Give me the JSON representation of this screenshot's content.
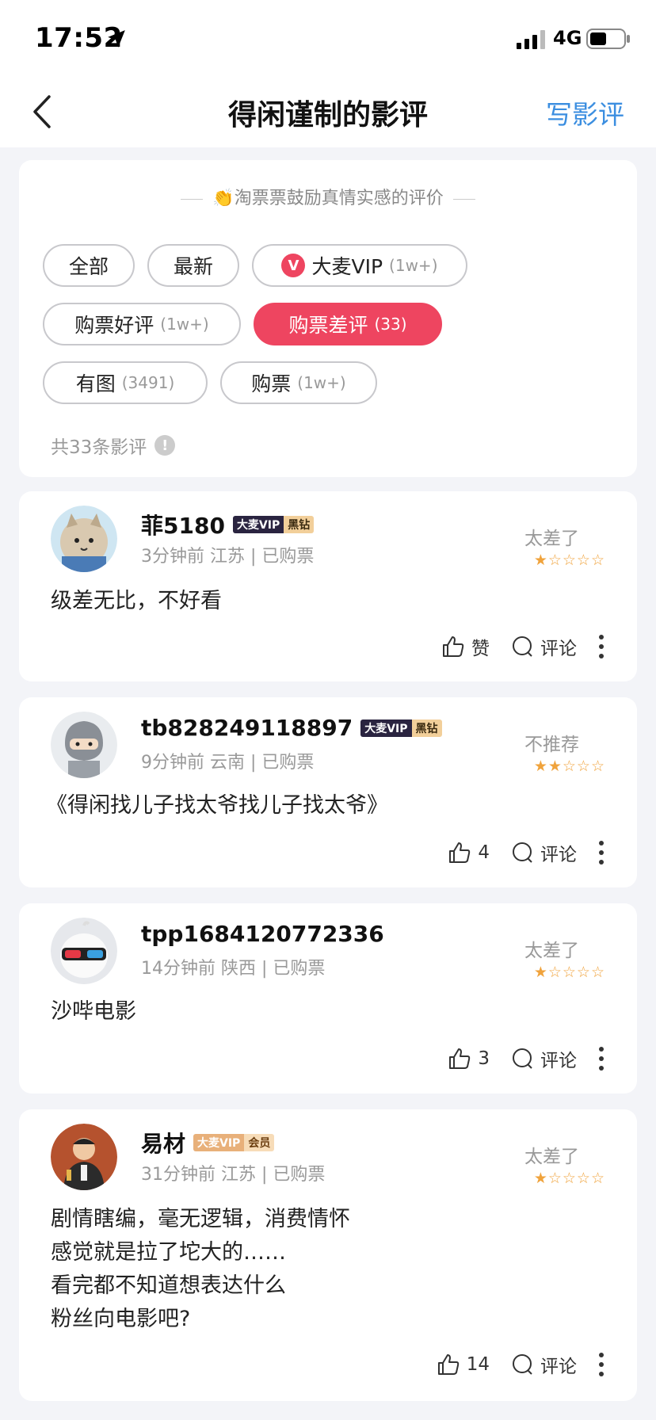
{
  "status": {
    "time": "17:52",
    "network": "4G"
  },
  "nav": {
    "title": "得闲谨制的影评",
    "action": "写影评"
  },
  "filter": {
    "encourage": "淘票票鼓励真情实感的评价",
    "chips": [
      {
        "label": "全部",
        "count": ""
      },
      {
        "label": "最新",
        "count": ""
      },
      {
        "label": "大麦VIP",
        "count": "(1w+)"
      },
      {
        "label": "购票好评",
        "count": "(1w+)"
      },
      {
        "label": "购票差评",
        "count": "(33)"
      },
      {
        "label": "有图",
        "count": "(3491)"
      },
      {
        "label": "购票",
        "count": "(1w+)"
      }
    ],
    "total": "共33条影评"
  },
  "reviews": [
    {
      "name": "菲5180",
      "badge": {
        "a": "大麦VIP",
        "b": "黑钻"
      },
      "meta": "3分钟前  江苏 | 已购票",
      "rating_label": "太差了",
      "stars": "★☆☆☆☆",
      "rating": 0.5,
      "content": "级差无比，不好看",
      "like": "赞",
      "comment": "评论"
    },
    {
      "name": "tb828249118897",
      "badge": {
        "a": "大麦VIP",
        "b": "黑钻"
      },
      "meta": "9分钟前  云南 | 已购票",
      "rating_label": "不推荐",
      "stars": "★★☆☆☆",
      "rating": 1.5,
      "content": "《得闲找儿子找太爷找儿子找太爷》",
      "like": "4",
      "comment": "评论"
    },
    {
      "name": "tpp1684120772336",
      "badge": null,
      "meta": "14分钟前  陕西 | 已购票",
      "rating_label": "太差了",
      "stars": "★☆☆☆☆",
      "rating": 1,
      "content": "沙哔电影",
      "like": "3",
      "comment": "评论"
    },
    {
      "name": "易材",
      "badge": {
        "a": "大麦VIP",
        "b": "会员"
      },
      "meta": "31分钟前  江苏 | 已购票",
      "rating_label": "太差了",
      "stars": "★☆☆☆☆",
      "rating": 0.5,
      "content": "剧情瞎编，毫无逻辑，消费情怀\n感觉就是拉了坨大的……\n看完都不知道想表达什么\n粉丝向电影吧?",
      "like": "14",
      "comment": "评论"
    }
  ],
  "colors": {
    "accent": "#ee4560",
    "link": "#3b8ee0",
    "star": "#f0a33c"
  }
}
